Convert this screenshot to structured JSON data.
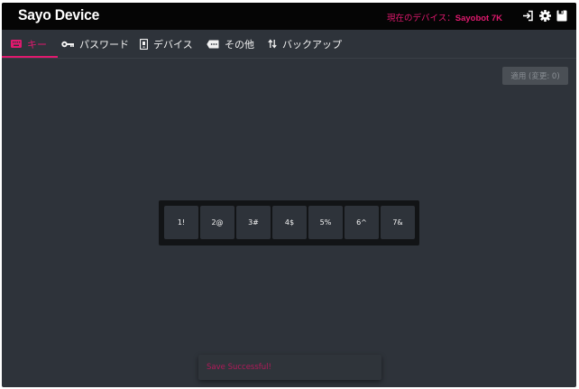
{
  "header": {
    "app_title": "Sayo Device",
    "device_label": "現在のデバイス：",
    "device_name": "Sayobot 7K",
    "icons": [
      "login-icon",
      "gear-icon",
      "save-icon"
    ]
  },
  "tabs": [
    {
      "label": "キー",
      "icon": "keyboard-icon",
      "active": true
    },
    {
      "label": "パスワード",
      "icon": "key-icon",
      "active": false
    },
    {
      "label": "デバイス",
      "icon": "device-icon",
      "active": false
    },
    {
      "label": "その他",
      "icon": "more-icon",
      "active": false
    },
    {
      "label": "バックアップ",
      "icon": "transfer-icon",
      "active": false
    }
  ],
  "apply_button": {
    "label": "適用 (変更: 0)",
    "enabled": false
  },
  "keys": [
    "1!",
    "2@",
    "3#",
    "4$",
    "5%",
    "6^",
    "7&"
  ],
  "toast": {
    "message": "Save Successful!"
  },
  "colors": {
    "accent": "#e0196e",
    "background": "#2e333a",
    "titlebar": "#050505",
    "key_plate": "#121416"
  }
}
